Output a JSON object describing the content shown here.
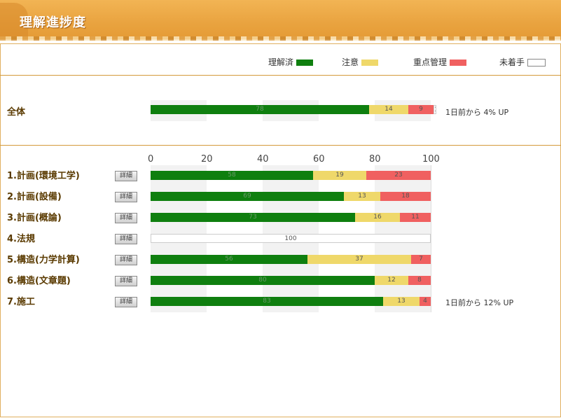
{
  "header": {
    "title": "理解進捗度"
  },
  "legend": [
    {
      "label": "理解済",
      "color": "#0f7f0f"
    },
    {
      "label": "注意",
      "color": "#efd86a"
    },
    {
      "label": "重点管理",
      "color": "#f06060"
    },
    {
      "label": "未着手",
      "color": "#ffffff"
    }
  ],
  "overall": {
    "label": "全体",
    "segments": [
      78,
      14,
      9,
      1
    ],
    "note": "1日前から 4% UP"
  },
  "axis_ticks": [
    "0",
    "20",
    "40",
    "60",
    "80",
    "100"
  ],
  "detail_button": "詳細",
  "rows": [
    {
      "label": "1.計画(環境工学)",
      "segments": [
        58,
        19,
        23,
        0
      ],
      "note": ""
    },
    {
      "label": "2.計画(設備)",
      "segments": [
        69,
        13,
        18,
        0
      ],
      "note": ""
    },
    {
      "label": "3.計画(概論)",
      "segments": [
        73,
        16,
        11,
        0
      ],
      "note": ""
    },
    {
      "label": "4.法規",
      "segments": [
        0,
        0,
        0,
        100
      ],
      "note": ""
    },
    {
      "label": "5.構造(力学計算)",
      "segments": [
        56,
        37,
        7,
        0
      ],
      "note": ""
    },
    {
      "label": "6.構造(文章題)",
      "segments": [
        80,
        12,
        8,
        0
      ],
      "note": ""
    },
    {
      "label": "7.施工",
      "segments": [
        83,
        13,
        4,
        0
      ],
      "note": "1日前から 12% UP"
    }
  ]
}
